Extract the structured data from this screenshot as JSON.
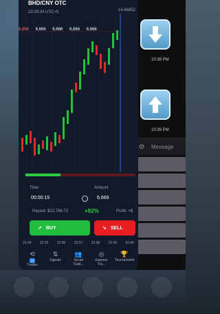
{
  "trading": {
    "pair": "BHD/CNY OTC",
    "time_utc": "23:29:24 UTC+5",
    "price_tag": "14.86852",
    "top_time": "22:39",
    "bid_labels": [
      "6,666",
      "6,666",
      "6,666",
      "6,666",
      "6,666",
      "6,666"
    ],
    "time_label": "Time",
    "time_value": "00:00:15",
    "amount_label": "Amount",
    "amount_value": "6,666",
    "payout_text": "Payout: $12,798.72",
    "percent_text": "+92%",
    "profit_text": "Profit: +$",
    "buy_label": "BUY",
    "sell_label": "SELL",
    "axis_times": [
      "22:34",
      "22:35",
      "22:36",
      "22:37",
      "22:38",
      "22:39",
      "22:40"
    ],
    "progress_fraction": 0.32,
    "nav": [
      {
        "label": "Trades",
        "badge": "13",
        "icon": "history-icon"
      },
      {
        "label": "Signals",
        "icon": "signals-icon"
      },
      {
        "label": "Social Tradi...",
        "icon": "social-icon"
      },
      {
        "label": "Express Tra...",
        "icon": "express-icon"
      },
      {
        "label": "Tournaments",
        "icon": "trophy-icon"
      }
    ]
  },
  "chat": {
    "down_time": "10:38 PM",
    "up_time": "10:39 PM",
    "placeholder": "Message"
  },
  "colors": {
    "buy": "#21bb3d",
    "sell": "#e81e23",
    "chart_bg": "#121a2a"
  }
}
